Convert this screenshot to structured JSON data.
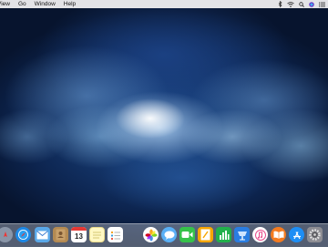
{
  "menubar": {
    "items": [
      "View",
      "Go",
      "Window",
      "Help"
    ],
    "status_icons": [
      "bluetooth-icon",
      "wifi-icon",
      "search-icon",
      "siri-icon",
      "notification-list-icon"
    ]
  },
  "dock": {
    "items": [
      {
        "name": "launchpad-icon",
        "color": "#8a96a8"
      },
      {
        "name": "safari-icon",
        "color": "#1e88e5"
      },
      {
        "name": "mail-icon",
        "color": "#f1f3f6"
      },
      {
        "name": "contacts-icon",
        "color": "#b48a52"
      },
      {
        "name": "calendar-icon",
        "color": "#ffffff",
        "label": "13"
      },
      {
        "name": "notes-icon",
        "color": "#fff8c4"
      },
      {
        "name": "reminders-icon",
        "color": "#ffffff"
      },
      {
        "name": "photos-icon",
        "color": "#ffffff"
      },
      {
        "name": "messages-icon",
        "color": "#5ab0f5"
      },
      {
        "name": "facetime-icon",
        "color": "#36c24a"
      },
      {
        "name": "pages-icon",
        "color": "#f7a600"
      },
      {
        "name": "numbers-icon",
        "color": "#22b14c"
      },
      {
        "name": "keynote-icon",
        "color": "#2a7de1"
      },
      {
        "name": "itunes-icon",
        "color": "#ffffff"
      },
      {
        "name": "ibooks-icon",
        "color": "#f47b20"
      },
      {
        "name": "app-store-icon",
        "color": "#1d8ef5"
      },
      {
        "name": "system-preferences-icon",
        "color": "#8d8d93"
      }
    ]
  }
}
